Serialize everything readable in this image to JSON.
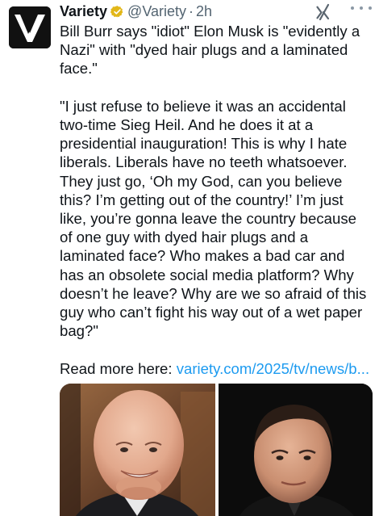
{
  "tweet": {
    "display_name": "Variety",
    "handle": "@Variety",
    "separator": "·",
    "time": "2h",
    "headline": "Bill Burr says \"idiot\" Elon Musk is \"evidently a Nazi\" with \"dyed hair plugs and a laminated face.\"",
    "quote": "\"I just refuse to believe it was an accidental two-time Sieg Heil. And he does it at a presidential inauguration! This is why I hate liberals. Liberals have no teeth whatsoever. They just go, ‘Oh my God, can you believe this? I’m getting out of the country!’ I’m just like, you’re gonna leave the country because of one guy with dyed hair plugs and a laminated face? Who makes a bad car and has an obsolete social media platform? Why doesn’t he leave? Why are we so afraid of this guy who can’t fight his way out of a wet paper bag?\"",
    "read_more_label": "Read more here:",
    "link_text": "variety.com/2025/tv/news/b..."
  },
  "icons": {
    "avatar": "variety-v-logo",
    "verified": "verified-badge-icon",
    "grok": "grok-icon",
    "more": "more-options-icon"
  },
  "colors": {
    "text": "#0f1419",
    "secondary": "#536471",
    "link": "#1d9bf0",
    "verified_badge": "#e2b719"
  }
}
